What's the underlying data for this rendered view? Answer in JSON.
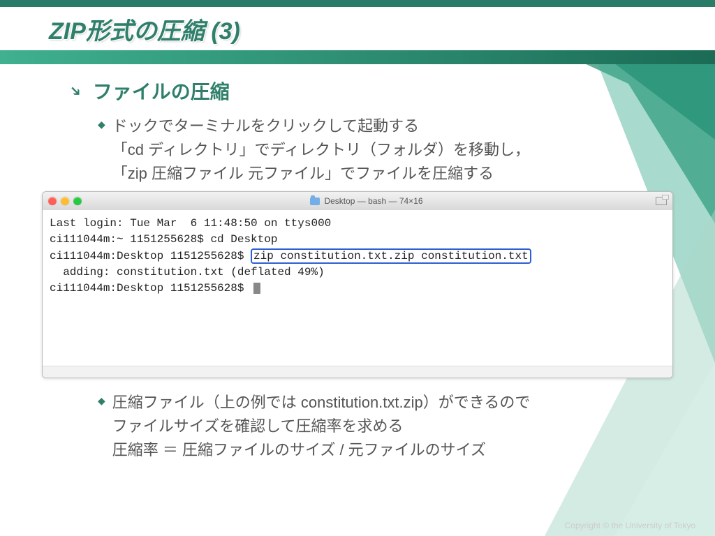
{
  "header": {
    "title": "ZIP形式の圧縮 (3)"
  },
  "section": {
    "title": "ファイルの圧縮"
  },
  "bullets": {
    "b1_line1": "ドックでターミナルをクリックして起動する",
    "b1_line2": "「cd ディレクトリ」でディレクトリ（フォルダ）を移動し，",
    "b1_line3": "「zip 圧縮ファイル 元ファイル」でファイルを圧縮する",
    "b2_line1": "圧縮ファイル（上の例では constitution.txt.zip）ができるので",
    "b2_line2": "ファイルサイズを確認して圧縮率を求める",
    "b2_line3": "圧縮率 ＝ 圧縮ファイルのサイズ / 元ファイルのサイズ"
  },
  "terminal": {
    "title": "Desktop — bash — 74×16",
    "lines": {
      "l1": "Last login: Tue Mar  6 11:48:50 on ttys000",
      "l2_prompt": "ci111044m:~ 1151255628$ ",
      "l2_cmd": "cd Desktop",
      "l3_prompt": "ci111044m:Desktop 1151255628$ ",
      "l3_cmd": "zip constitution.txt.zip constitution.txt",
      "l4": "  adding: constitution.txt (deflated 49%)",
      "l5_prompt": "ci111044m:Desktop 1151255628$ "
    }
  },
  "footer": {
    "copyright": "Copyright © the University of Tokyo"
  }
}
